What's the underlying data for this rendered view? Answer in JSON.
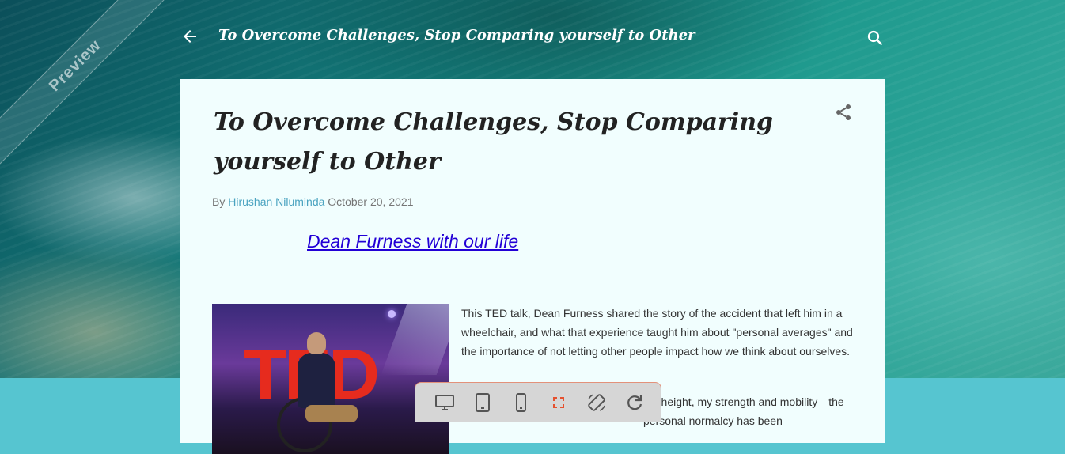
{
  "ribbon": {
    "label": "Preview"
  },
  "topbar": {
    "title": "To Overcome Challenges, Stop Comparing yourself to Other"
  },
  "post": {
    "title": "To Overcome Challenges, Stop Comparing yourself to Other",
    "by_label": "By",
    "author": "Hirushan Niluminda",
    "date": "October 20, 2021",
    "link_heading": "Dean Furness with our life",
    "paragraph1": "This TED talk, Dean Furness shared the story of the accident that left him in a wheelchair, and what that experience taught him about \"personal averages\" and the importance of not letting other people impact how we think about ourselves.",
    "paragraph2": "my height, my strength and mobility—the personal normalcy has been",
    "image_alt_text": "TED"
  },
  "toolbar": {
    "items": [
      "desktop-icon",
      "tablet-icon",
      "phone-icon",
      "fullscreen-icon",
      "rotate-icon",
      "refresh-icon"
    ],
    "active_color": "#e5512f"
  }
}
